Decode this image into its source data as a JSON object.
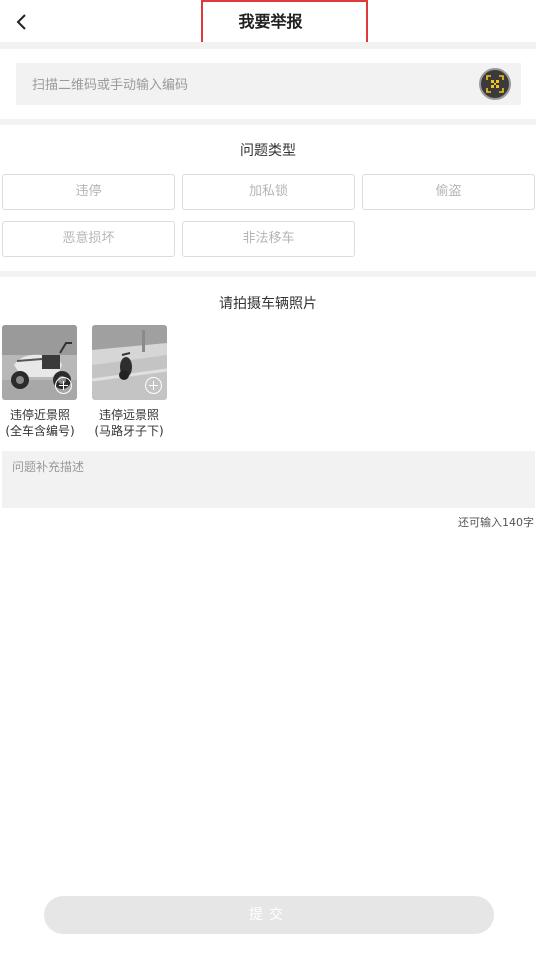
{
  "header": {
    "title": "我要举报",
    "back_icon": "chevron-left-icon"
  },
  "scan": {
    "placeholder": "扫描二维码或手动输入编码",
    "icon": "qr-scan-icon",
    "accent": "#f5c518"
  },
  "problem_types": {
    "title": "问题类型",
    "options": [
      "违停",
      "加私锁",
      "偷盗",
      "恶意损坏",
      "非法移车"
    ]
  },
  "photos": {
    "title": "请拍摄车辆照片",
    "items": [
      {
        "line1": "违停近景照",
        "line2": "(全车含编号)"
      },
      {
        "line1": "违停远景照",
        "line2": "(马路牙子下)"
      }
    ]
  },
  "description": {
    "placeholder": "问题补充描述",
    "counter": "还可输入140字"
  },
  "submit": {
    "label": "提交"
  },
  "colors": {
    "highlight_border": "#e0393b",
    "disabled_button": "#e6e6e6"
  }
}
